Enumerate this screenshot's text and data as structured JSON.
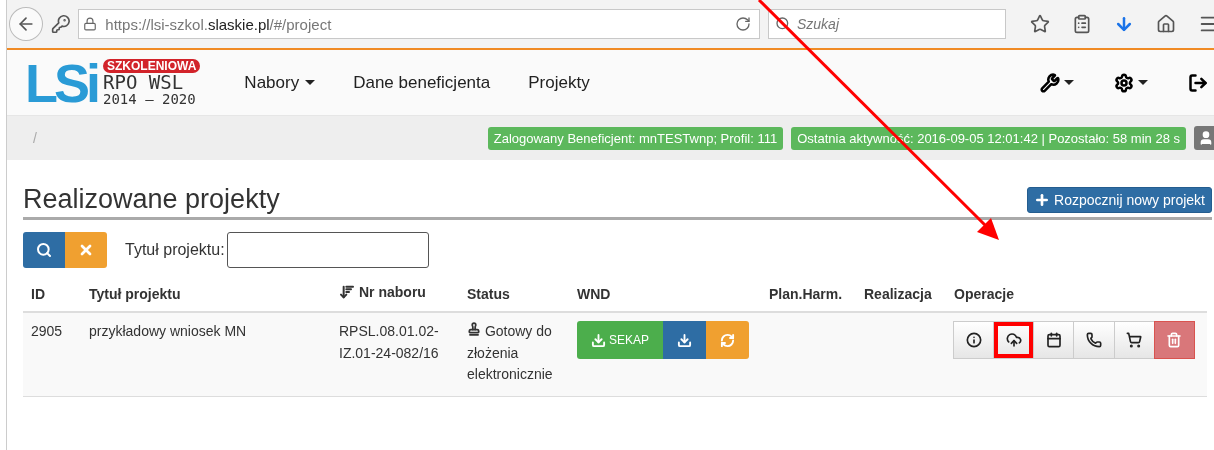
{
  "browser": {
    "url": "https://lsi-szkol.**slaskie.pl**/#/project",
    "search_placeholder": "Szukaj"
  },
  "logo": {
    "mark": "LSi",
    "badge": "SZKOLENIOWA",
    "line1": "RPO WSL",
    "line2": "2014 – 2020"
  },
  "nav": [
    {
      "label": "Nabory",
      "dropdown": true
    },
    {
      "label": "Dane beneficjenta",
      "dropdown": false
    },
    {
      "label": "Projekty",
      "dropdown": false
    }
  ],
  "tools": [
    {
      "kind": "wrench",
      "dropdown": true
    },
    {
      "kind": "gear",
      "dropdown": true
    },
    {
      "kind": "logout",
      "dropdown": false
    }
  ],
  "breadcrumb": "/",
  "status_labels": [
    "Zalogowany Beneficjent: mnTESTwnp; Profil: 111",
    "Ostatnia aktywność: 2016-09-05 12:01:42 | Pozostało: 58 min 28 s"
  ],
  "title": "Realizowane projekty",
  "new_project_button": "Rozpocznij nowy projekt",
  "filter": {
    "label": "Tytuł projektu:"
  },
  "table": {
    "columns": [
      {
        "label": "ID",
        "sorted": false
      },
      {
        "label": "Tytuł projektu",
        "sorted": false
      },
      {
        "label": "Nr naboru",
        "sorted": true
      },
      {
        "label": "Status",
        "sorted": false
      },
      {
        "label": "WND",
        "sorted": false
      },
      {
        "label": "Plan.Harm.",
        "sorted": false
      },
      {
        "label": "Realizacja",
        "sorted": false
      },
      {
        "label": "Operacje",
        "sorted": false
      }
    ],
    "rows": [
      {
        "id": "2905",
        "title": "przykładowy wniosek MN",
        "nabor": "RPSL.08.01.02-IZ.01-24-082/16",
        "status": "Gotowy do złożenia elektronicznie",
        "wnd": [
          {
            "kind": "sekap",
            "label": "SEKAP"
          },
          {
            "kind": "download"
          },
          {
            "kind": "refresh"
          }
        ],
        "operations": [
          {
            "kind": "info",
            "highlighted": false
          },
          {
            "kind": "upload",
            "highlighted": true
          },
          {
            "kind": "calendar",
            "highlighted": false
          },
          {
            "kind": "phone",
            "highlighted": false
          },
          {
            "kind": "cart",
            "highlighted": false
          },
          {
            "kind": "delete",
            "highlighted": false
          }
        ]
      }
    ]
  }
}
